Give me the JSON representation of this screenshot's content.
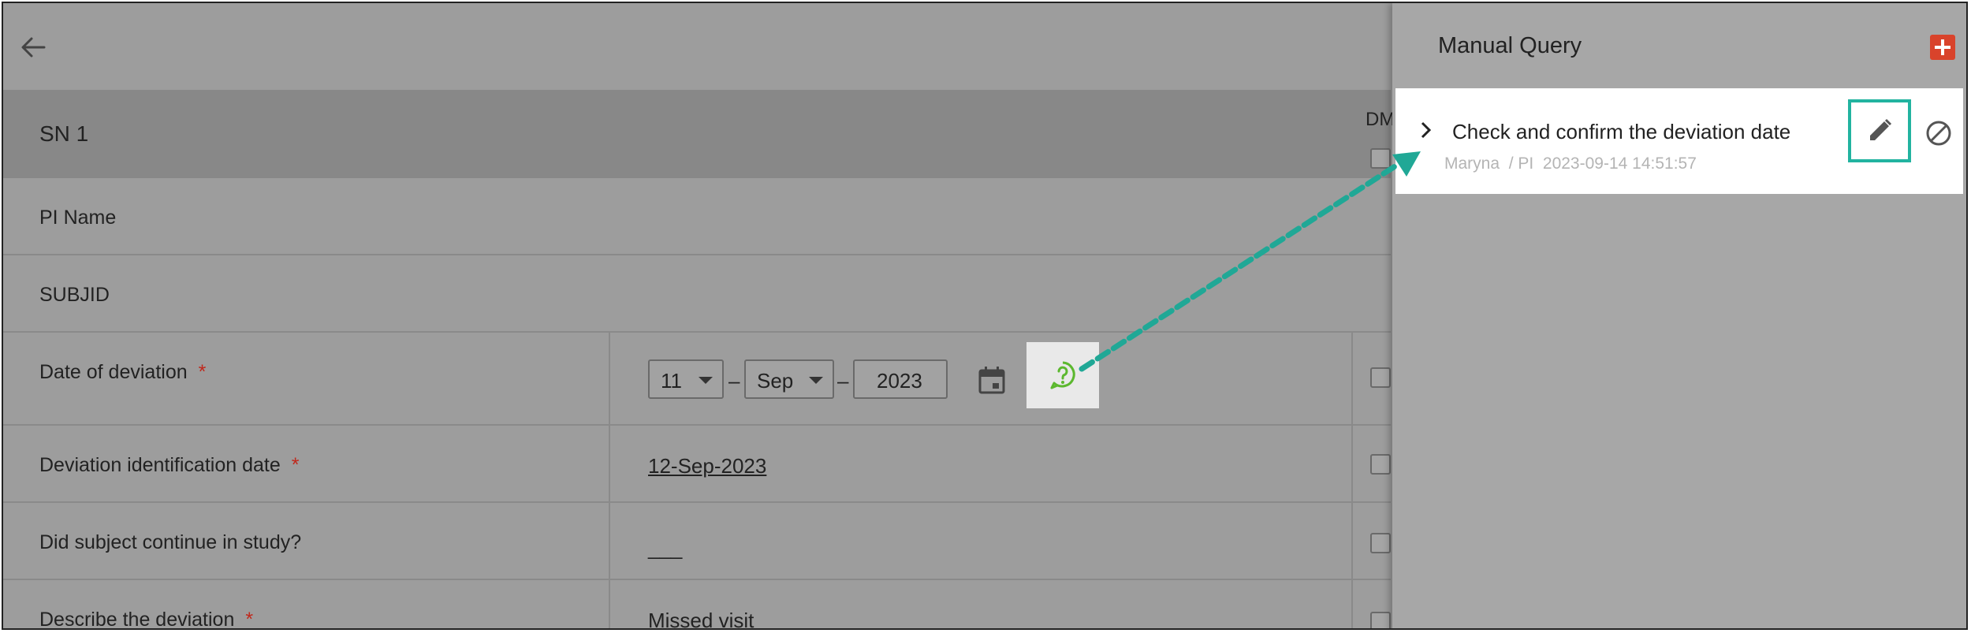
{
  "form": {
    "section_title": "SN 1",
    "dm_label": "DM",
    "rows": {
      "pi_name": {
        "label": "PI Name"
      },
      "subjid": {
        "label": "SUBJID"
      },
      "date_of_deviation": {
        "label": "Date of deviation",
        "required": "*",
        "day": "11",
        "month": "Sep",
        "year": "2023",
        "separator": "–"
      },
      "identification_date": {
        "label": "Deviation identification date",
        "required": "*",
        "value": "12-Sep-2023"
      },
      "continue_in_study": {
        "label": "Did subject continue in study?",
        "value": "___"
      },
      "describe": {
        "label": "Describe the deviation",
        "required": "*",
        "value": "Missed visit"
      }
    }
  },
  "panel": {
    "title": "Manual Query",
    "query": {
      "text": "Check and confirm the deviation date",
      "author": "Maryna",
      "role": "/ PI",
      "timestamp": "2023-09-14 14:51:57"
    }
  },
  "icons": {
    "back": "arrow-left-icon",
    "calendar": "calendar-icon",
    "help": "query-help-icon",
    "add": "plus-icon",
    "chevron": "chevron-right-icon",
    "edit": "pencil-icon",
    "block": "block-icon"
  },
  "colors": {
    "accent_teal": "#22b3a0",
    "add_button": "#d9432b",
    "required": "#c0281c",
    "help_green": "#5cb82f"
  }
}
